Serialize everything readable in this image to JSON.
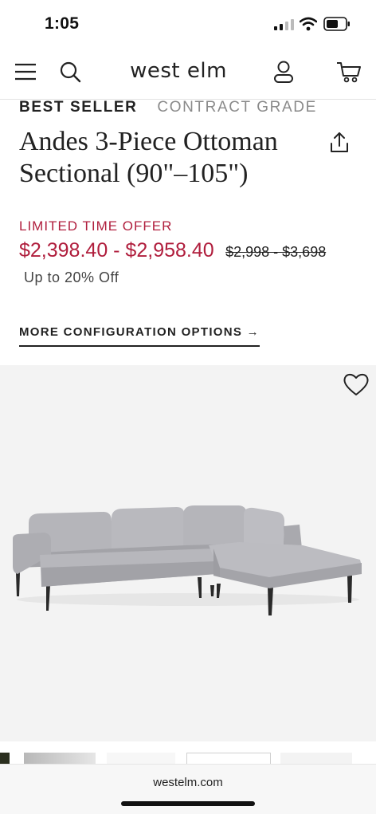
{
  "status": {
    "time": "1:05"
  },
  "header": {
    "brand": "west elm"
  },
  "badges": {
    "best_seller": "BEST SELLER",
    "contract_grade": "CONTRACT GRADE"
  },
  "product": {
    "title": "Andes 3-Piece Ottoman Sectional (90\"–105\")",
    "offer_label": "LIMITED TIME OFFER",
    "price_range": "$2,398.40 - $2,958.40",
    "original_price": "$2,998 - $3,698",
    "discount": "Up to 20% Off",
    "config_link": "MORE CONFIGURATION OPTIONS →"
  },
  "browser": {
    "url": "westelm.com"
  },
  "colors": {
    "sale_red": "#b01e3d",
    "text": "#222222",
    "muted": "#8a8a8a",
    "gallery_bg": "#f3f3f3"
  },
  "icons": [
    "menu-icon",
    "search-icon",
    "account-icon",
    "cart-icon",
    "share-icon",
    "heart-icon",
    "signal-icon",
    "wifi-icon",
    "battery-icon"
  ]
}
